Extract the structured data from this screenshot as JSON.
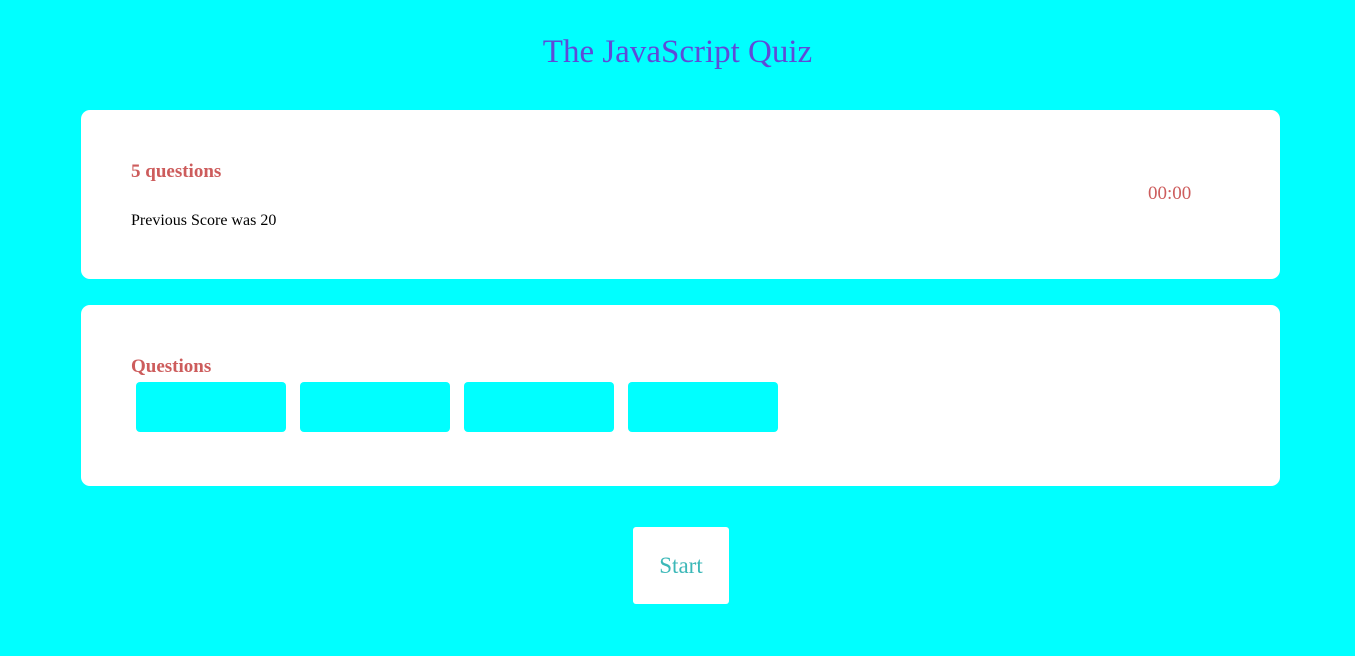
{
  "page": {
    "title": "The JavaScript Quiz"
  },
  "info": {
    "question_count": "5 questions",
    "previous_score": "Previous Score was 20",
    "timer": "00:00"
  },
  "questions_panel": {
    "label": "Questions",
    "slots": [
      "",
      "",
      "",
      ""
    ]
  },
  "actions": {
    "start_label": "Start"
  },
  "colors": {
    "background": "#00ffff",
    "title": "#5e4bd8",
    "accent": "#cd5c5c",
    "start_text": "#3cb8b8",
    "card": "#ffffff"
  }
}
